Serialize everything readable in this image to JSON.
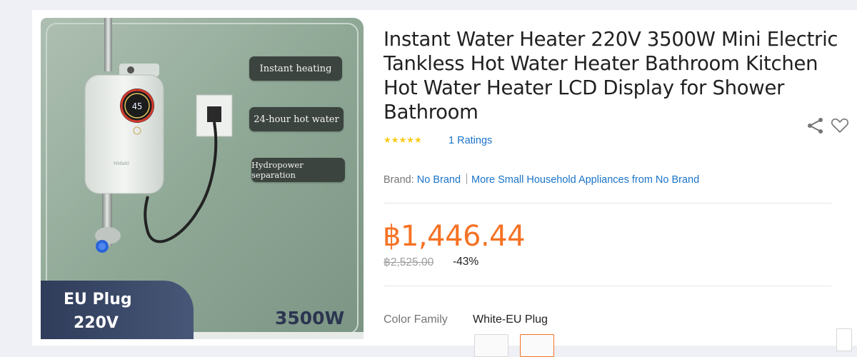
{
  "product": {
    "title": "Instant Water Heater 220V 3500W Mini Electric Tankless Hot Water Heater Bathroom Kitchen Hot Water Heater LCD Display for Shower Bathroom",
    "stars": "★★★★★",
    "ratings": "1 Ratings",
    "brand_label": "Brand:",
    "brand_name": "No Brand",
    "brand_more": "More Small Household Appliances from No Brand",
    "price": "฿1,446.44",
    "original_price": "฿2,525.00",
    "discount": "-43%",
    "color_family_label": "Color Family",
    "color_family_value": "White-EU Plug"
  },
  "image_overlay": {
    "features": [
      "Instant heating",
      "24-hour hot water",
      "Hydropower separation"
    ],
    "plug_line1": "EU Plug",
    "plug_line2": "220V",
    "power": "3500W",
    "display_digits": "45",
    "heater_brand": "Hidaki"
  },
  "icons": {
    "share": "share-icon",
    "wishlist": "heart-icon"
  },
  "colors": {
    "price": "#f57224",
    "link": "#1a73c8",
    "star": "#faca15"
  }
}
